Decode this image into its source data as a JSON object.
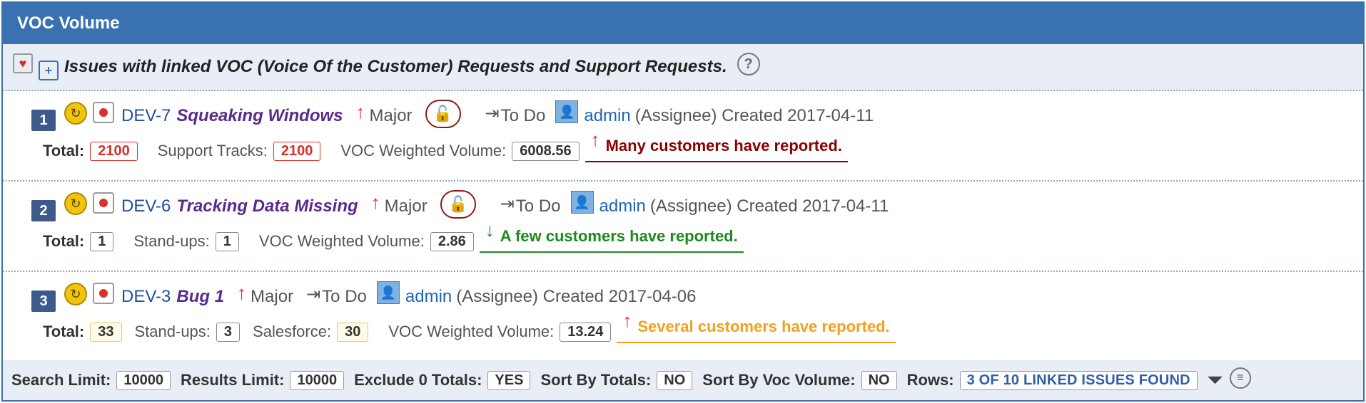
{
  "panel": {
    "title": "VOC Volume"
  },
  "subtitle": {
    "text": "Issues with linked VOC (Voice Of the Customer) Requests and Support Requests."
  },
  "rows": [
    {
      "rank": "1",
      "key": "DEV-7",
      "summary": "Squeaking Windows",
      "priority": "Major",
      "status": "To Do",
      "assignee": "admin",
      "role": "(Assignee) Created 2017-04-11",
      "metrics": [
        {
          "label": "Total:",
          "value": "2100",
          "style": "red"
        },
        {
          "label": "Support Tracks:",
          "value": "2100",
          "style": "red"
        },
        {
          "label": "VOC Weighted Volume:",
          "value": "6008.56",
          "style": "plain"
        }
      ],
      "message": "Many customers have reported.",
      "message_color": "#8b0000",
      "message_arrow": "up"
    },
    {
      "rank": "2",
      "key": "DEV-6",
      "summary": "Tracking Data Missing",
      "priority": "Major",
      "status": "To Do",
      "assignee": "admin",
      "role": "(Assignee) Created 2017-04-11",
      "metrics": [
        {
          "label": "Total:",
          "value": "1",
          "style": "plain"
        },
        {
          "label": "Stand-ups:",
          "value": "1",
          "style": "plain"
        },
        {
          "label": "VOC Weighted Volume:",
          "value": "2.86",
          "style": "plain"
        }
      ],
      "message": "A few customers have reported.",
      "message_color": "#1e8a1e",
      "message_arrow": "down"
    },
    {
      "rank": "3",
      "key": "DEV-3",
      "summary": "Bug 1",
      "priority": "Major",
      "status": "To Do",
      "assignee": "admin",
      "role": "(Assignee) Created 2017-04-06",
      "metrics": [
        {
          "label": "Total:",
          "value": "33",
          "style": "yellow"
        },
        {
          "label": "Stand-ups:",
          "value": "3",
          "style": "plain"
        },
        {
          "label": "Salesforce:",
          "value": "30",
          "style": "yellow"
        },
        {
          "label": "VOC Weighted Volume:",
          "value": "13.24",
          "style": "plain"
        }
      ],
      "message": "Several customers have reported.",
      "message_color": "#f2a11f",
      "message_arrow": "up"
    }
  ],
  "footer": {
    "search_limit_label": "Search Limit:",
    "search_limit": "10000",
    "results_limit_label": "Results Limit:",
    "results_limit": "10000",
    "exclude_label": "Exclude 0 Totals:",
    "exclude": "YES",
    "sort_totals_label": "Sort By Totals:",
    "sort_totals": "NO",
    "sort_voc_label": "Sort By Voc Volume:",
    "sort_voc": "NO",
    "rows_label": "Rows:",
    "rows_value": "3 OF 10 LINKED ISSUES FOUND"
  }
}
